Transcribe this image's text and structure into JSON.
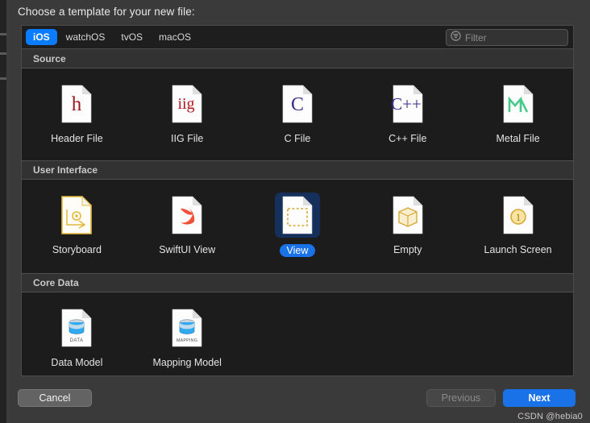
{
  "dialog": {
    "title": "Choose a template for your new file:"
  },
  "toolbar": {
    "tabs": [
      {
        "label": "iOS",
        "active": true
      },
      {
        "label": "watchOS",
        "active": false
      },
      {
        "label": "tvOS",
        "active": false
      },
      {
        "label": "macOS",
        "active": false
      }
    ],
    "filter": {
      "placeholder": "Filter",
      "value": "",
      "icon": "filter-circle-icon"
    }
  },
  "sections": [
    {
      "title": "Source",
      "items": [
        {
          "label": "Header File",
          "icon": "h-file-icon"
        },
        {
          "label": "IIG File",
          "icon": "iig-file-icon"
        },
        {
          "label": "C File",
          "icon": "c-file-icon"
        },
        {
          "label": "C++ File",
          "icon": "cpp-file-icon"
        },
        {
          "label": "Metal File",
          "icon": "metal-file-icon"
        }
      ]
    },
    {
      "title": "User Interface",
      "items": [
        {
          "label": "Storyboard",
          "icon": "storyboard-icon"
        },
        {
          "label": "SwiftUI View",
          "icon": "swift-bird-icon"
        },
        {
          "label": "View",
          "icon": "view-file-icon",
          "selected": true
        },
        {
          "label": "Empty",
          "icon": "empty-cube-icon"
        },
        {
          "label": "Launch Screen",
          "icon": "launch-screen-icon"
        }
      ]
    },
    {
      "title": "Core Data",
      "items": [
        {
          "label": "Data Model",
          "icon": "data-model-icon"
        },
        {
          "label": "Mapping Model",
          "icon": "mapping-model-icon"
        }
      ]
    }
  ],
  "footer": {
    "cancel_label": "Cancel",
    "previous_label": "Previous",
    "next_label": "Next",
    "previous_disabled": true
  },
  "watermark": "CSDN @hebia0",
  "colors": {
    "accent_blue": "#1a72e8",
    "tab_blue": "#0a7cff",
    "selection_bg": "#16305c",
    "panel_bg": "#1c1c1c",
    "section_header_bg": "#323232"
  }
}
